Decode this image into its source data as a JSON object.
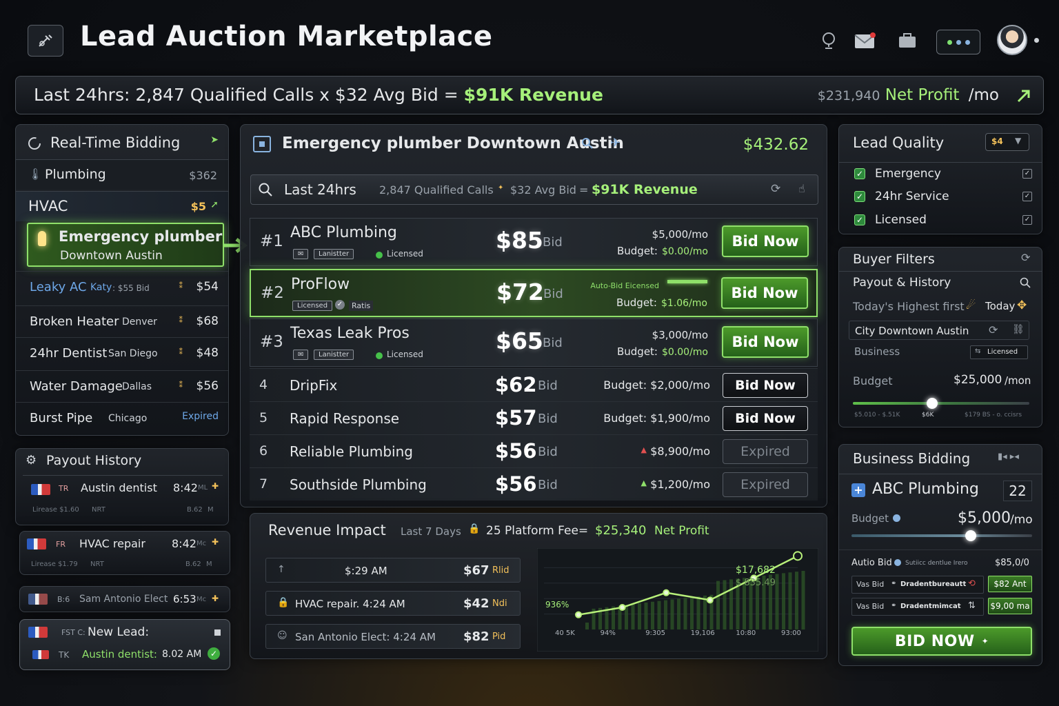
{
  "app": {
    "title": "Lead Auction Marketplace"
  },
  "banner": {
    "text_a": "Last 24hrs: 2,847 Qualified Calls x $32 Avg Bid = ",
    "text_b": "$91K Revenue",
    "profit_val": "$231,940",
    "profit_label": "Net Profit",
    "profit_unit": "/mo"
  },
  "rtb": {
    "title": "Real-Time Bidding",
    "plumbing": {
      "label": "Plumbing",
      "price": "$362"
    },
    "hvac": {
      "label": "HVAC",
      "price": "$5"
    },
    "featured": {
      "line1": "Emergency plumber",
      "line2": "Downtown Austin"
    },
    "items": [
      {
        "name": "Leaky AC",
        "city": "Katy",
        "extra": ": $55 Bid",
        "price": "$54"
      },
      {
        "name": "Broken Heater",
        "city": "Denver",
        "extra": "",
        "price": "$68"
      },
      {
        "name": "24hr Dentist",
        "city": "San Diego",
        "extra": "",
        "price": "$48"
      },
      {
        "name": "Water Damage",
        "city": "Dallas",
        "extra": "",
        "price": "$56"
      },
      {
        "name": "Burst Pipe",
        "city": "Chicago",
        "extra": "",
        "price": "Expired"
      }
    ]
  },
  "payout": {
    "title": "Payout History",
    "items": [
      {
        "code": "TR",
        "label": "Austin dentist",
        "time": "8:42",
        "ampm": "ML",
        "sub": "Lirease $1.60",
        "sub2": "NRT",
        "sub3": "B.62",
        "sub4": "M"
      },
      {
        "code": "FR",
        "label": "HVAC repair",
        "time": "8:42",
        "ampm": "Mc",
        "sub": "Lirease $1.79",
        "sub2": "NRT",
        "sub3": "B.62",
        "sub4": "M"
      },
      {
        "code": "B:6",
        "label": "Sam Antonio Elect",
        "time": "6:53",
        "ampm": "Mc"
      }
    ],
    "newlead": {
      "code": "FST C:",
      "label": "New Lead:",
      "code2": "TK",
      "text": "Austin dentist:",
      "time": "8.02 AM"
    }
  },
  "center": {
    "title": "Emergency plumber Downtown Austin",
    "price": "$432.62",
    "search": {
      "label": "Last 24hrs",
      "calls": "2,847 Qualified Calls",
      "avg": "$32 Avg Bid",
      "eq": "=",
      "rev": "$91K Revenue"
    },
    "bid_suffix": "Bid",
    "ranked": [
      {
        "rank": "#1",
        "name": "ABC Plumbing",
        "bid": "$85",
        "tag1": "Lanistter",
        "tag2": "Licensed",
        "top": "$5,000/mo",
        "budget_label": "Budget:",
        "budget": "$0.00/mo",
        "btn": "Bid Now"
      },
      {
        "rank": "#2",
        "name": "ProFlow",
        "bid": "$72",
        "tag1": "Licensed",
        "tag2": "Ratis",
        "top": "Auto-Bid Eicensed",
        "budget_label": "Budget:",
        "budget": "$1.06/mo",
        "btn": "Bid Now"
      },
      {
        "rank": "#3",
        "name": "Texas Leak Pros",
        "bid": "$65",
        "tag1": "Lanistter",
        "tag2": "Licensed",
        "top": "$3,000/mo",
        "budget_label": "Budget:",
        "budget": "$0.00/mo",
        "btn": "Bid Now"
      }
    ],
    "others": [
      {
        "rank": "4",
        "name": "DripFix",
        "bid": "$62",
        "budget": "Budget: $2,000/mo",
        "btn": "Bid Now",
        "state": "active"
      },
      {
        "rank": "5",
        "name": "Rapid Response",
        "bid": "$57",
        "budget": "Budget: $1,900/mo",
        "btn": "Bid Now",
        "state": "active"
      },
      {
        "rank": "6",
        "name": "Reliable Plumbing",
        "bid": "$56",
        "budget": "$8,900/mo",
        "btn": "Expired",
        "state": "expired"
      },
      {
        "rank": "7",
        "name": "Southside Plumbing",
        "bid": "$56",
        "budget": "$1,200/mo",
        "btn": "Expired",
        "state": "expired"
      }
    ]
  },
  "revenue": {
    "title": "Revenue Impact",
    "period": "Last 7 Days",
    "fee": "25 Platform Fee=",
    "profit": "$25,340",
    "profit_label": "Net Profit",
    "items": [
      {
        "label": "$:29 AM",
        "price": "$67",
        "suffix": "Rlid"
      },
      {
        "label": "HVAC repair. 4:24 AM",
        "price": "$42",
        "suffix": "Ndi"
      },
      {
        "label": "San Antonio Elect: 4:24 AM",
        "price": "$82",
        "suffix": "Pid"
      }
    ],
    "chart": {
      "pct": "936%",
      "v1": "$17,682",
      "v2": "$ 835.49",
      "ticks": [
        "40 5K",
        "94%",
        "9:305",
        "19,106",
        "10:80",
        "93:00"
      ]
    }
  },
  "chart_data": {
    "type": "line",
    "x": [
      "40 5K",
      "94%",
      "9:305",
      "19,106",
      "10:80",
      "93:00"
    ],
    "values": [
      2,
      3,
      5,
      4,
      7,
      10
    ],
    "annotations": [
      "936%",
      "$17,682",
      "$ 835.49"
    ]
  },
  "quality": {
    "title": "Lead Quality",
    "badge": "$4",
    "items": [
      "Emergency",
      "24hr Service",
      "Licensed"
    ]
  },
  "filters": {
    "title": "Buyer Filters",
    "payout": "Payout & History",
    "sort": "Today's Highest first",
    "today": "Today",
    "city": "City Downtown Austin",
    "business": "Business",
    "licensed": "Licensed",
    "budget_label": "Budget",
    "budget": "$25,000",
    "budget_unit": "/mon",
    "range_lo": "$5.010 - $.51K",
    "range_mid": "$6K",
    "range_hi": "$179 BS - o. ccisrs",
    "slider_frac": 0.45
  },
  "biz": {
    "title": "Business Bidding",
    "name": "ABC Plumbing",
    "count": "22",
    "budget_label": "Budget",
    "budget": "$5,000",
    "budget_unit": "/mo",
    "slider_frac": 0.66,
    "auto_label": "Autio Bid",
    "auto_desc": "Sutiicc dentlue Irero",
    "auto_val": "$85,0/0",
    "rows": [
      {
        "label": "Vas Bid",
        "name": "Dradentbureautt",
        "val": "$82 Ant"
      },
      {
        "label": "Vas Bid",
        "name": "Dradentmimcat",
        "val": "$9,00 ma"
      }
    ],
    "cta": "BID NOW"
  }
}
